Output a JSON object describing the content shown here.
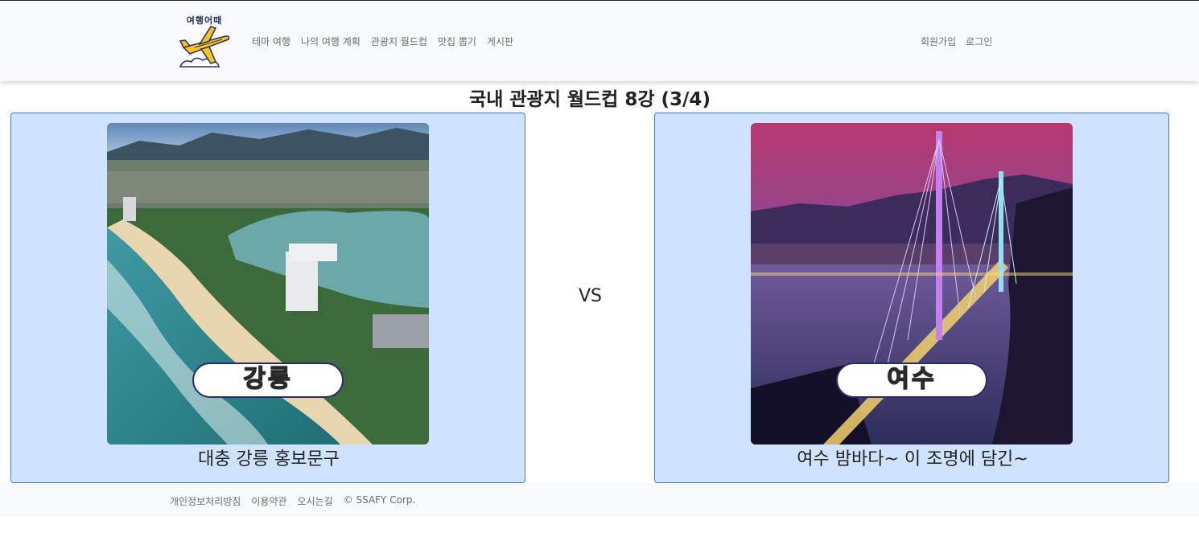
{
  "header": {
    "logo_text": "여행어때",
    "nav_left": [
      "테마 여행",
      "나의 여행 계획",
      "관광지 월드컵",
      "맛집 뽑기",
      "게시판"
    ],
    "nav_right": [
      "회원가입",
      "로그인"
    ]
  },
  "page_title": "국내 관광지 월드컵 8강 (3/4)",
  "vs_label": "VS",
  "candidates": [
    {
      "badge": "강릉",
      "caption": "대충 강릉 홍보문구"
    },
    {
      "badge": "여수",
      "caption": "여수 밤바다~ 이 조명에 담긴~"
    }
  ],
  "footer": {
    "links": [
      "개인정보처리방침",
      "이용약관",
      "오시는길",
      "© SSAFY Corp."
    ]
  }
}
